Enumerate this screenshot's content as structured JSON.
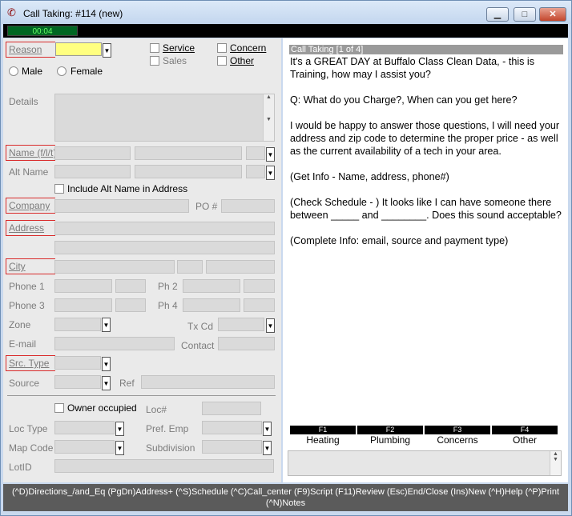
{
  "window": {
    "title": "Call Taking: #114 (new)",
    "timer": "00:04"
  },
  "form": {
    "reason_label": "Reason",
    "service_label": "Service",
    "concern_label": "Concern",
    "sales_label": "Sales",
    "other_label": "Other",
    "male_label": "Male",
    "female_label": "Female",
    "details_label": "Details",
    "name_label": "Name (f/l/t)",
    "altname_label": "Alt Name",
    "include_alt_label": "Include Alt Name in Address",
    "company_label": "Company",
    "po_label": "PO #",
    "address_label": "Address",
    "city_label": "City",
    "phone1_label": "Phone 1",
    "ph2_label": "Ph 2",
    "phone3_label": "Phone 3",
    "ph4_label": "Ph 4",
    "zone_label": "Zone",
    "txcd_label": "Tx Cd",
    "email_label": "E-mail",
    "contact_label": "Contact",
    "srctype_label": "Src. Type",
    "source_label": "Source",
    "ref_label": "Ref",
    "owner_label": "Owner occupied",
    "locnum_label": "Loc#",
    "loctype_label": "Loc Type",
    "prefemp_label": "Pref. Emp",
    "mapcode_label": "Map Code",
    "subdivision_label": "Subdivision",
    "lotid_label": "LotID"
  },
  "script": {
    "header": "Call Taking [1 of 4]",
    "paragraphs": [
      "It's a GREAT DAY at Buffalo Class Clean Data, - this is Training, how may I assist you?",
      "Q:  What do you Charge?,  When can you get here?",
      "I would be happy to answer those questions, I will need your address and zip code to determine the proper price - as well as the current availability of a tech in your area.",
      "(Get Info - Name, address, phone#)",
      "(Check Schedule - )  It looks like I can have someone there between _____ and ________.  Does this sound acceptable?",
      "(Complete Info:  email,  source and payment type)"
    ],
    "fkeys": [
      {
        "key": "F1",
        "name": "Heating"
      },
      {
        "key": "F2",
        "name": "Plumbing"
      },
      {
        "key": "F3",
        "name": "Concerns"
      },
      {
        "key": "F4",
        "name": "Other"
      }
    ]
  },
  "statusbar": {
    "line1": "(^D)Directions_/and_Eq  (PgDn)Address+  (^S)Schedule  (^C)Call_center  (F9)Script  (F11)Review  (Esc)End/Close  (Ins)New  (^H)Help  (^P)Print",
    "line2": "(^N)Notes"
  },
  "icons": {
    "app": "callcenter-icon",
    "minimize": "minimize-icon",
    "maximize": "maximize-icon",
    "close": "close-icon"
  },
  "colors": {
    "required_border": "#d92b2b",
    "reason_field": "#ffff80",
    "timer_text": "#66ff66"
  }
}
